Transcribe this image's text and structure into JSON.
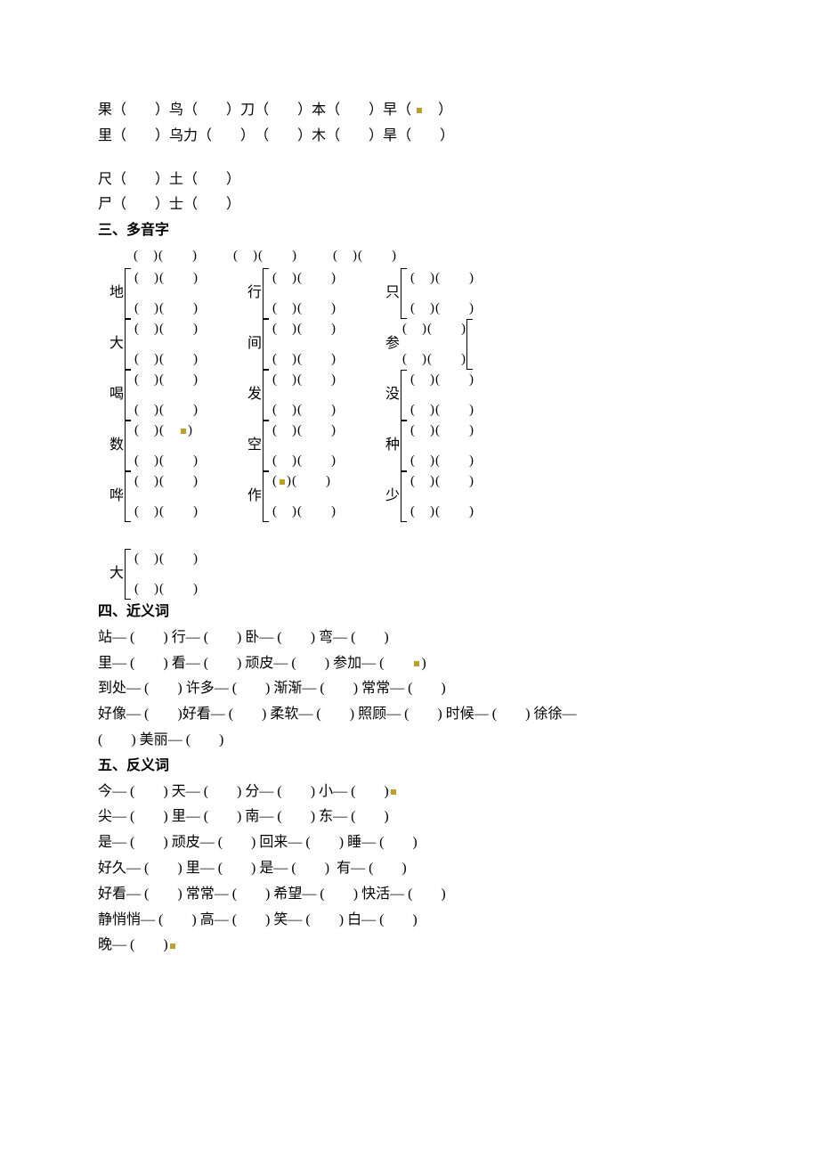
{
  "section2_pairs": {
    "row1": {
      "top": [
        "果",
        "鸟",
        "刀",
        "本",
        "早"
      ],
      "bot": [
        "里",
        "乌力",
        "",
        "木",
        "旱"
      ]
    },
    "row2": {
      "top": [
        "尺",
        "土"
      ],
      "bot": [
        "尸",
        "士"
      ]
    }
  },
  "section3": {
    "title": "三、多音字",
    "rows": [
      [
        "地",
        "行",
        "只"
      ],
      [
        "大",
        "间",
        "参"
      ],
      [
        "喝",
        "发",
        "没"
      ],
      [
        "数",
        "空",
        "种"
      ],
      [
        "哗",
        "作",
        "少"
      ]
    ],
    "extra": "大"
  },
  "section4": {
    "title": "四、近义词",
    "lines": [
      [
        [
          "站"
        ],
        [
          "行"
        ],
        [
          "卧"
        ],
        [
          "弯"
        ]
      ],
      [
        [
          "里"
        ],
        [
          "看"
        ],
        [
          "顽皮"
        ],
        [
          "参加"
        ]
      ],
      [
        [
          "到处"
        ],
        [
          "许多"
        ],
        [
          "渐渐"
        ],
        [
          "常常"
        ]
      ],
      [
        [
          "好像"
        ],
        [
          "好看"
        ],
        [
          "柔软"
        ],
        [
          "照顾"
        ],
        [
          "时候"
        ],
        [
          "徐徐"
        ]
      ],
      [
        [
          "美丽"
        ]
      ]
    ]
  },
  "section5": {
    "title": "五、反义词",
    "lines": [
      [
        [
          "今"
        ],
        [
          "天"
        ],
        [
          "分"
        ],
        [
          "小"
        ]
      ],
      [
        [
          "尖"
        ],
        [
          "里"
        ],
        [
          "南"
        ],
        [
          "东"
        ]
      ],
      [
        [
          "是"
        ],
        [
          "顽皮"
        ],
        [
          "回来"
        ],
        [
          "睡"
        ]
      ],
      [
        [
          "好久"
        ],
        [
          "里"
        ],
        [
          "是"
        ],
        [
          "有"
        ]
      ],
      [
        [
          "好看"
        ],
        [
          "常常"
        ],
        [
          "希望"
        ],
        [
          "快活"
        ]
      ],
      [
        [
          "静悄悄"
        ],
        [
          "高"
        ],
        [
          "笑"
        ],
        [
          "白"
        ]
      ],
      [
        [
          "晚"
        ]
      ]
    ]
  }
}
